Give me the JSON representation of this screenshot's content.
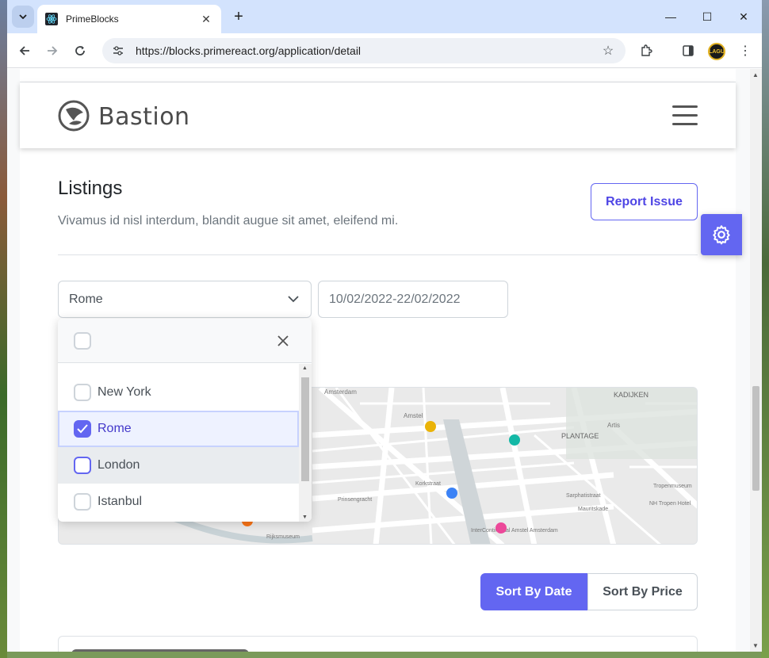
{
  "browser": {
    "tab_title": "PrimeBlocks",
    "url": "https://blocks.primereact.org/application/detail",
    "profile_badge": "LAGU"
  },
  "header": {
    "logo_text": "Bastion"
  },
  "listings": {
    "title": "Listings",
    "subtitle": "Vivamus id nisl interdum, blandit augue sit amet, eleifend mi.",
    "report_button": "Report Issue"
  },
  "filters": {
    "city_value": "Rome",
    "date_range": "10/02/2022-22/02/2022",
    "options": [
      {
        "label": "New York",
        "checked": false
      },
      {
        "label": "Rome",
        "checked": true
      },
      {
        "label": "London",
        "checked": false
      },
      {
        "label": "Istanbul",
        "checked": false
      }
    ]
  },
  "map": {
    "labels": [
      "Amsterdam",
      "Amstel",
      "KADIJKEN",
      "PLANTAGE",
      "Artis",
      "Korkstraat",
      "Prinsengracht",
      "Sarphatistraat",
      "Tropenmuseum",
      "Mauritskade",
      "NH Tropen Hotel",
      "InterContinental Amstel Amsterdam",
      "Rijksmuseum"
    ],
    "marker_colors": [
      "#eab308",
      "#14b8a6",
      "#3b82f6",
      "#ec4899",
      "#f97316"
    ]
  },
  "sort": {
    "by_date": "Sort By Date",
    "by_price": "Sort By Price"
  },
  "colors": {
    "accent": "#6366f1"
  }
}
